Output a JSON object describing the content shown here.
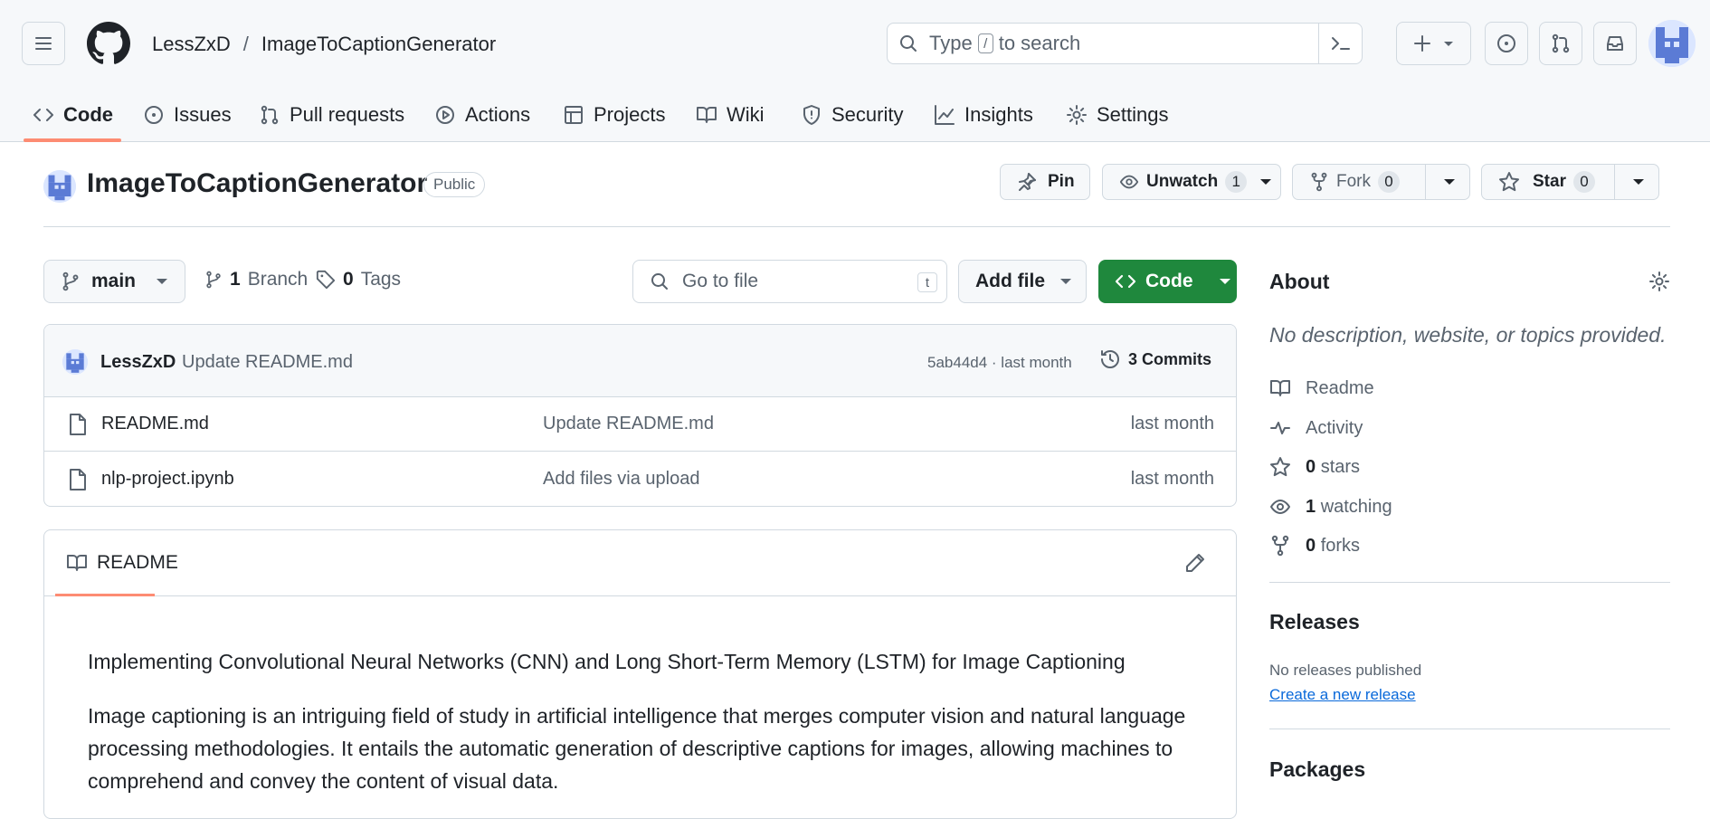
{
  "breadcrumb": {
    "owner": "LessZxD",
    "separator": "/",
    "repo": "ImageToCaptionGenerator"
  },
  "search": {
    "prefix": "Type",
    "key": "/",
    "suffix": "to search"
  },
  "tabs": [
    {
      "label": "Code",
      "icon": "code-icon"
    },
    {
      "label": "Issues",
      "icon": "issue-icon"
    },
    {
      "label": "Pull requests",
      "icon": "pull-request-icon"
    },
    {
      "label": "Actions",
      "icon": "play-icon"
    },
    {
      "label": "Projects",
      "icon": "table-icon"
    },
    {
      "label": "Wiki",
      "icon": "book-icon"
    },
    {
      "label": "Security",
      "icon": "shield-icon"
    },
    {
      "label": "Insights",
      "icon": "graph-icon"
    },
    {
      "label": "Settings",
      "icon": "gear-icon"
    }
  ],
  "repo": {
    "name": "ImageToCaptionGenerator",
    "visibility": "Public",
    "pin_label": "Pin",
    "unwatch_label": "Unwatch",
    "watch_count": "1",
    "fork_label": "Fork",
    "fork_count": "0",
    "star_label": "Star",
    "star_count": "0"
  },
  "filenav": {
    "branch": "main",
    "branches_count": "1",
    "branches_label": "Branch",
    "tags_count": "0",
    "tags_label": "Tags",
    "goto_placeholder": "Go to file",
    "goto_key": "t",
    "add_file": "Add file",
    "code": "Code"
  },
  "commit": {
    "author": "LessZxD",
    "message": "Update README.md",
    "hash_time": "5ab44d4 · last month",
    "commits_label": "3 Commits"
  },
  "files": [
    {
      "name": "README.md",
      "message": "Update README.md",
      "date": "last month"
    },
    {
      "name": "nlp-project.ipynb",
      "message": "Add files via upload",
      "date": "last month"
    }
  ],
  "readme": {
    "tab": "README",
    "paragraphs": [
      "Implementing Convolutional Neural Networks (CNN) and Long Short-Term Memory (LSTM) for Image Captioning",
      "Image captioning is an intriguing field of study in artificial intelligence that merges computer vision and natural language processing methodologies. It entails the automatic generation of descriptive captions for images, allowing machines to comprehend and convey the content of visual data."
    ]
  },
  "about": {
    "title": "About",
    "description": "No description, website, or topics provided.",
    "readme": "Readme",
    "activity": "Activity",
    "stars_count": "0",
    "stars_label": "stars",
    "watching_count": "1",
    "watching_label": "watching",
    "forks_count": "0",
    "forks_label": "forks"
  },
  "releases": {
    "title": "Releases",
    "none": "No releases published",
    "create": "Create a new release"
  },
  "packages": {
    "title": "Packages"
  },
  "colors": {
    "accent_green": "#1f883d",
    "tab_underline": "#fd8c73",
    "link": "#0969da"
  }
}
